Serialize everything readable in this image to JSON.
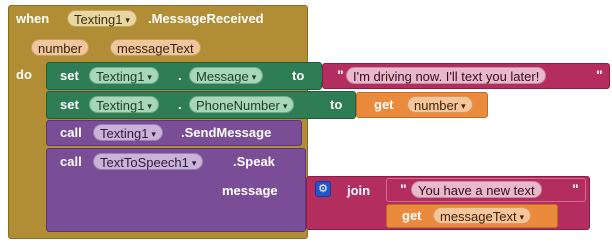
{
  "event": {
    "when": "when",
    "component": "Texting1",
    "event_name": ".MessageReceived",
    "params": [
      "number",
      "messageText"
    ],
    "do": "do"
  },
  "set1": {
    "set": "set",
    "component": "Texting1",
    "dot": ".",
    "property": "Message",
    "to": "to",
    "text": "I'm driving now. I'll text you later!"
  },
  "set2": {
    "set": "set",
    "component": "Texting1",
    "dot": ".",
    "property": "PhoneNumber",
    "to": "to",
    "get": "get",
    "var": "number"
  },
  "call1": {
    "call": "call",
    "component": "Texting1",
    "method": ".SendMessage"
  },
  "call2": {
    "call": "call",
    "component": "TextToSpeech1",
    "method": ".Speak",
    "arg_label": "message",
    "join": "join",
    "text": "You have a new text",
    "get": "get",
    "var": "messageText"
  },
  "quote_char": "\"",
  "caret_char": "▾",
  "colors": {
    "event": "#b18e35",
    "setter": "#2f7d55",
    "call": "#7a4e96",
    "text": "#b32d5e",
    "get": "#e98a3c"
  }
}
